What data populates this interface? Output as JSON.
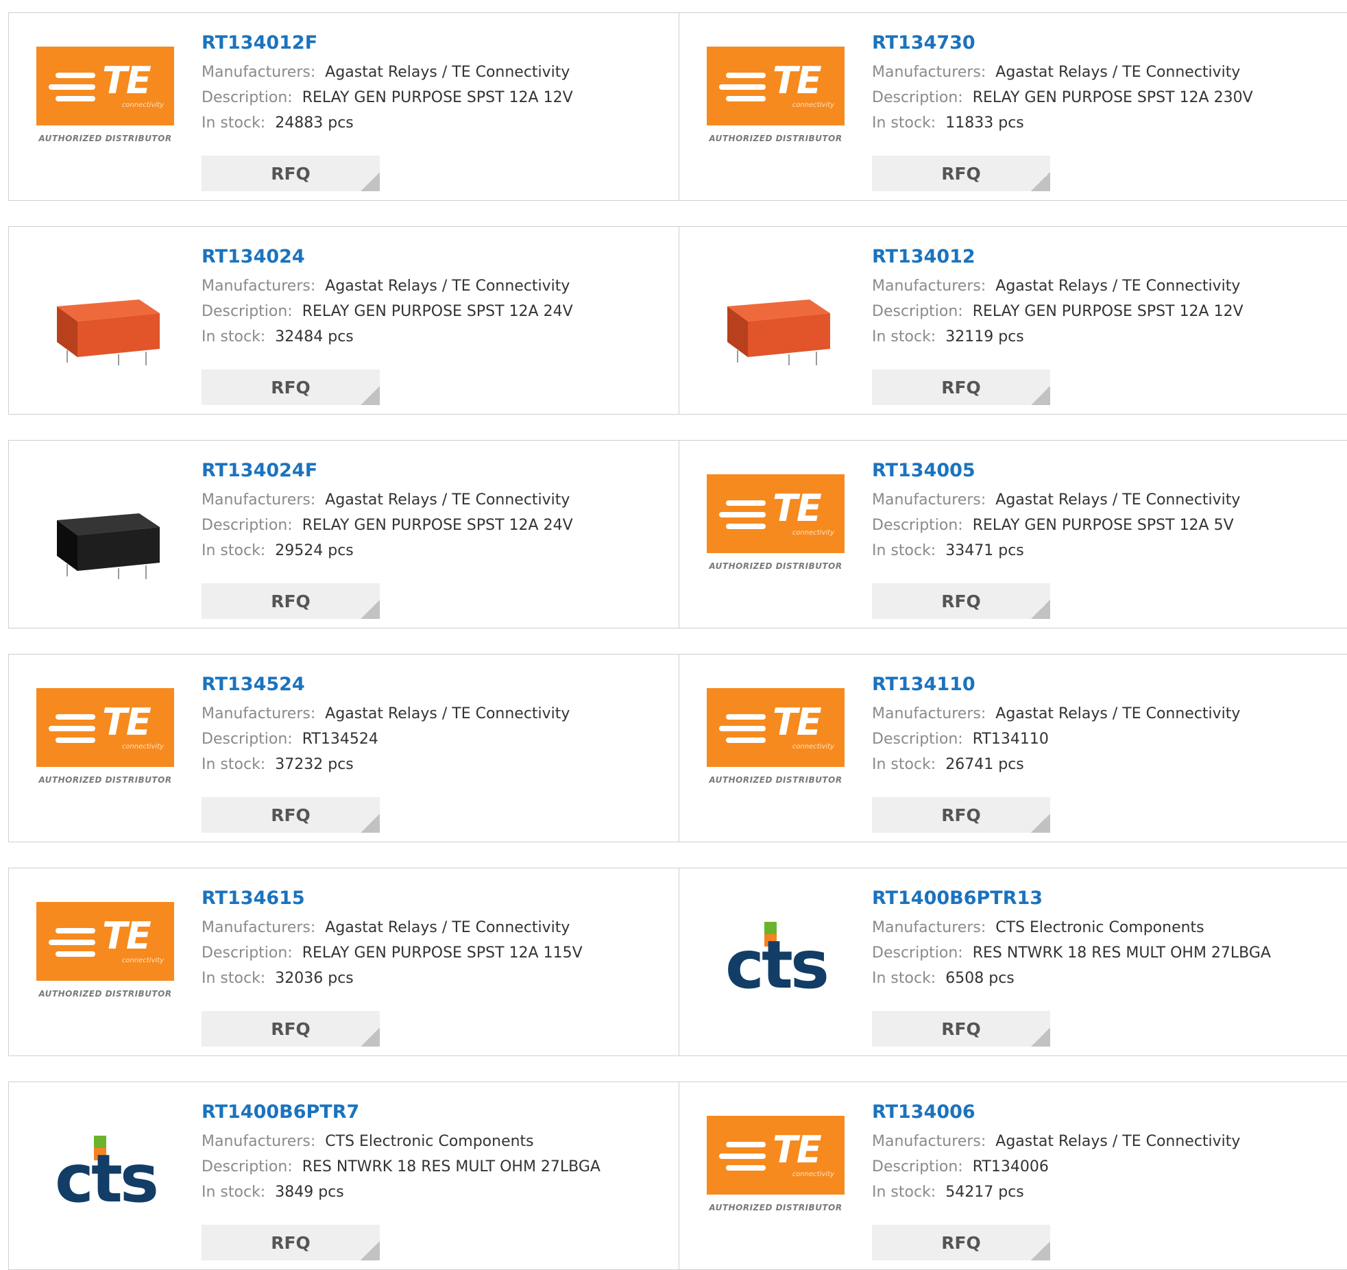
{
  "labels": {
    "manufacturers": "Manufacturers:",
    "description": "Description:",
    "in_stock": "In stock:",
    "stock_unit": "pcs",
    "rfq": "RFQ"
  },
  "logo_text": {
    "te_word": "TE",
    "te_sub": "connectivity",
    "te_distributor": "AUTHORIZED DISTRIBUTOR",
    "cts_word": "cts"
  },
  "colors": {
    "part_link": "#1b73be",
    "te_orange": "#f68a1e",
    "cts_navy": "#123d66",
    "cts_green": "#6ab42d",
    "cts_orange": "#f58220",
    "relay_orange": "#e2542a",
    "relay_black": "#1e1e1e"
  },
  "products": [
    {
      "part": "RT134012F",
      "manufacturer": "Agastat Relays / TE Connectivity",
      "description": "RELAY GEN PURPOSE SPST 12A 12V",
      "stock": "24883",
      "image": "te-logo"
    },
    {
      "part": "RT134730",
      "manufacturer": "Agastat Relays / TE Connectivity",
      "description": "RELAY GEN PURPOSE SPST 12A 230V",
      "stock": "11833",
      "image": "te-logo"
    },
    {
      "part": "RT134024",
      "manufacturer": "Agastat Relays / TE Connectivity",
      "description": "RELAY GEN PURPOSE SPST 12A 24V",
      "stock": "32484",
      "image": "relay-orange"
    },
    {
      "part": "RT134012",
      "manufacturer": "Agastat Relays / TE Connectivity",
      "description": "RELAY GEN PURPOSE SPST 12A 12V",
      "stock": "32119",
      "image": "relay-orange"
    },
    {
      "part": "RT134024F",
      "manufacturer": "Agastat Relays / TE Connectivity",
      "description": "RELAY GEN PURPOSE SPST 12A 24V",
      "stock": "29524",
      "image": "relay-black"
    },
    {
      "part": "RT134005",
      "manufacturer": "Agastat Relays / TE Connectivity",
      "description": "RELAY GEN PURPOSE SPST 12A 5V",
      "stock": "33471",
      "image": "te-logo"
    },
    {
      "part": "RT134524",
      "manufacturer": "Agastat Relays / TE Connectivity",
      "description": "RT134524",
      "stock": "37232",
      "image": "te-logo"
    },
    {
      "part": "RT134110",
      "manufacturer": "Agastat Relays / TE Connectivity",
      "description": "RT134110",
      "stock": "26741",
      "image": "te-logo"
    },
    {
      "part": "RT134615",
      "manufacturer": "Agastat Relays / TE Connectivity",
      "description": "RELAY GEN PURPOSE SPST 12A 115V",
      "stock": "32036",
      "image": "te-logo"
    },
    {
      "part": "RT1400B6PTR13",
      "manufacturer": "CTS Electronic Components",
      "description": "RES NTWRK 18 RES MULT OHM 27LBGA",
      "stock": "6508",
      "image": "cts-logo"
    },
    {
      "part": "RT1400B6PTR7",
      "manufacturer": "CTS Electronic Components",
      "description": "RES NTWRK 18 RES MULT OHM 27LBGA",
      "stock": "3849",
      "image": "cts-logo"
    },
    {
      "part": "RT134006",
      "manufacturer": "Agastat Relays / TE Connectivity",
      "description": "RT134006",
      "stock": "54217",
      "image": "te-logo"
    }
  ]
}
